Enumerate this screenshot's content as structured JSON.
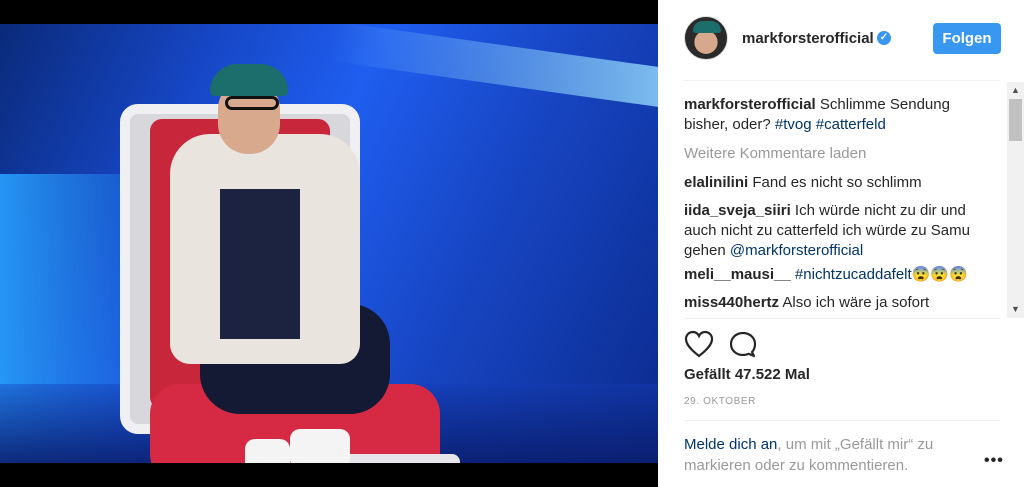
{
  "post": {
    "username": "markforsterofficial",
    "follow_label": "Folgen",
    "caption_user": "markforsterofficial",
    "caption_text": "Schlimme Sendung bisher, oder?",
    "caption_tags": [
      "#tvog",
      "#catterfeld"
    ],
    "load_more_label": "Weitere Kommentare laden",
    "likes_text": "Gefällt 47.522 Mal",
    "date_text": "29. OKTOBER",
    "more_label": "•••"
  },
  "comments": [
    {
      "user": "elalinilini",
      "text": "Fand es nicht so schlimm",
      "tag": ""
    },
    {
      "user": "iida_sveja_siiri",
      "text": "Ich würde nicht zu dir und auch nicht zu catterfeld ich würde zu Samu gehen",
      "tag": "@markforsterofficial"
    },
    {
      "user": "meli__mausi__",
      "text": "",
      "tag": "#nichtzucaddafelt",
      "emoji": "😨😨😨"
    },
    {
      "user": "miss440hertz",
      "text": "Also ich wäre ja sofort",
      "tag": ""
    }
  ],
  "login": {
    "link_text": "Melde dich an",
    "rest_text": ", um mit „Gefällt mir“ zu markieren oder zu kommentieren."
  },
  "icons": {
    "verified": "verified-badge-icon",
    "like": "heart-icon",
    "comment": "comment-bubble-icon",
    "scroll_up": "scroll-up-arrow-icon",
    "scroll_down": "scroll-down-arrow-icon"
  },
  "colors": {
    "accent": "#3897f0",
    "link": "#003569",
    "muted": "#999999"
  }
}
